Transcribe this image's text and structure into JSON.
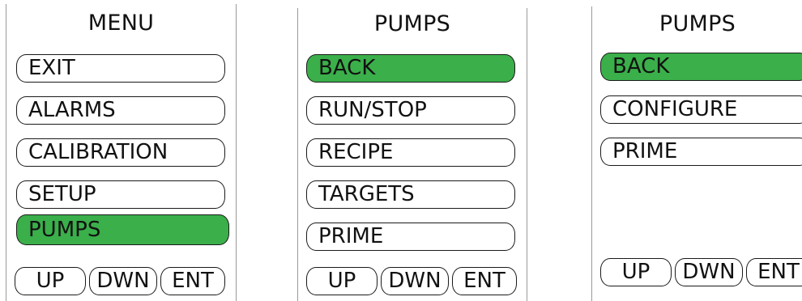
{
  "screens": [
    {
      "title": "MENU",
      "items": [
        "EXIT",
        "ALARMS",
        "CALIBRATION",
        "SETUP",
        "PUMPS"
      ],
      "selected_index": 4,
      "softkeys": [
        "UP",
        "DWN",
        "ENT"
      ]
    },
    {
      "title": "PUMPS",
      "items": [
        "BACK",
        "RUN/STOP",
        "RECIPE",
        "TARGETS",
        "PRIME"
      ],
      "selected_index": 0,
      "softkeys": [
        "UP",
        "DWN",
        "ENT"
      ]
    },
    {
      "title": "PUMPS",
      "items": [
        "BACK",
        "CONFIGURE",
        "PRIME"
      ],
      "selected_index": 0,
      "softkeys": [
        "UP",
        "DWN",
        "ENT"
      ]
    }
  ],
  "colors": {
    "selected": "#3aaf4a",
    "outline": "#1a1a1a"
  }
}
